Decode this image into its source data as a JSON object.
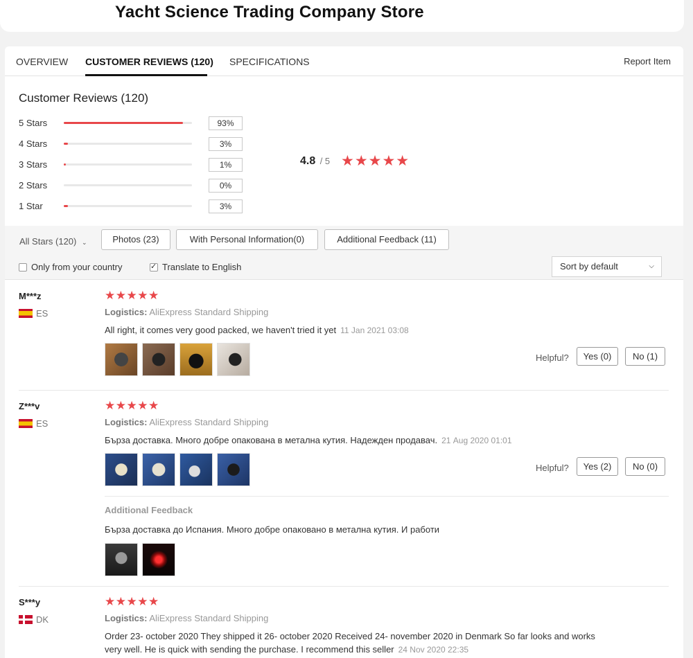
{
  "store": {
    "title": "Yacht Science Trading Company Store"
  },
  "tabs": [
    {
      "label": "OVERVIEW",
      "active": false
    },
    {
      "label": "CUSTOMER REVIEWS (120)",
      "active": true
    },
    {
      "label": "SPECIFICATIONS",
      "active": false
    }
  ],
  "report_label": "Report Item",
  "summary": {
    "title": "Customer Reviews (120)",
    "average": "4.8",
    "out_of": "/ 5",
    "stars": "★★★★★",
    "distribution": [
      {
        "label": "5 Stars",
        "percent": "93%",
        "fraction": 0.93
      },
      {
        "label": "4 Stars",
        "percent": "3%",
        "fraction": 0.03
      },
      {
        "label": "3 Stars",
        "percent": "1%",
        "fraction": 0.01
      },
      {
        "label": "2 Stars",
        "percent": "0%",
        "fraction": 0.0
      },
      {
        "label": "1 Star",
        "percent": "3%",
        "fraction": 0.03
      }
    ]
  },
  "filters": {
    "all_stars": "All Stars (120)",
    "buttons": [
      "Photos (23)",
      "With Personal Information(0)",
      "Additional Feedback (11)"
    ],
    "only_country": {
      "label": "Only from your country",
      "checked": false
    },
    "translate": {
      "label": "Translate to English",
      "checked": true
    },
    "sort": "Sort by default"
  },
  "reviews": [
    {
      "name": "M***z",
      "country": "ES",
      "stars": "★★★★★",
      "logistics_label": "Logistics:",
      "logistics": "AliExpress Standard Shipping",
      "text": "All right, it comes very good packed, we haven't tried it yet",
      "date": "11 Jan 2021 03:08",
      "helpful_label": "Helpful?",
      "yes": "Yes (0)",
      "no": "No (1)"
    },
    {
      "name": "Z***v",
      "country": "ES",
      "stars": "★★★★★",
      "logistics_label": "Logistics:",
      "logistics": "AliExpress Standard Shipping",
      "text": "Бърза доставка. Много добре опакована в метална кутия. Надежден продавач.",
      "date": "21 Aug 2020 01:01",
      "helpful_label": "Helpful?",
      "yes": "Yes (2)",
      "no": "No (0)",
      "additional_title": "Additional Feedback",
      "additional_text": "Бърза доставка до Испания. Много добре опаковано в метална кутия. И работи"
    },
    {
      "name": "S***y",
      "country": "DK",
      "stars": "★★★★★",
      "logistics_label": "Logistics:",
      "logistics": "AliExpress Standard Shipping",
      "text": "Order 23- october 2020 They shipped it 26- october 2020 Received 24- november 2020 in Denmark So far looks and works very well. He is quick with sending the purchase. I recommend this seller",
      "date": "24 Nov 2020 22:35"
    }
  ]
}
